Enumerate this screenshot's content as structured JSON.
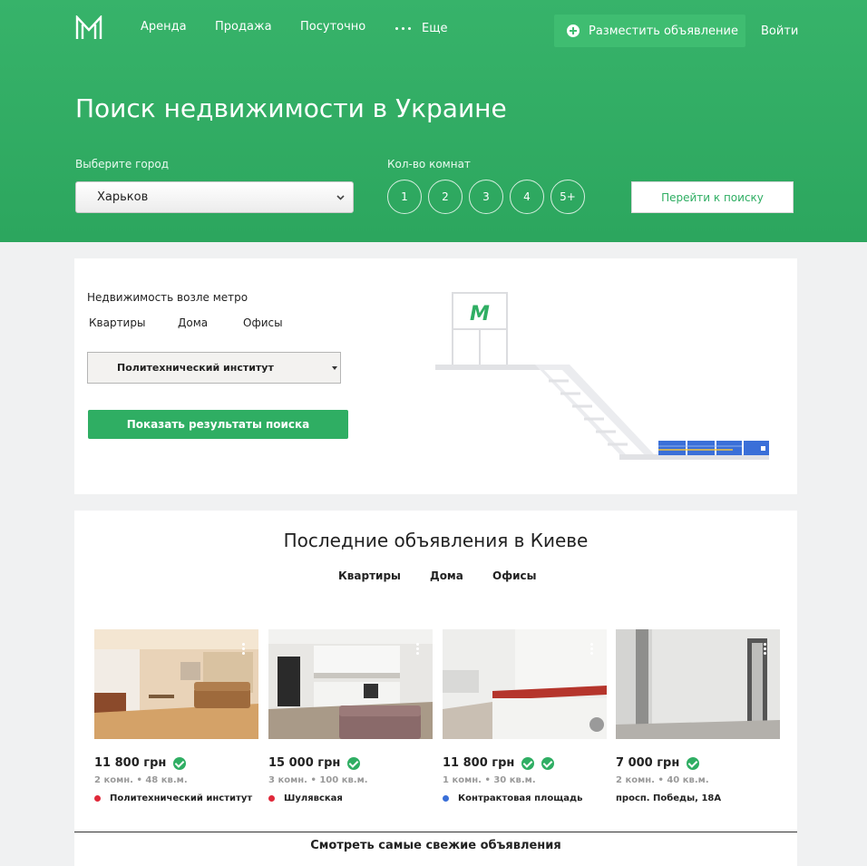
{
  "colors": {
    "brand_green": "#2fae63",
    "hero_green": "#37b36a",
    "metro_dot_red": "#e0293a",
    "metro_dot_blue": "#3a6fd8"
  },
  "header": {
    "logo_icon": "m-logo-icon",
    "nav": [
      "Аренда",
      "Продажа",
      "Посуточно"
    ],
    "more_label": "Еще",
    "post_ad_label": "Разместить объявление",
    "login_label": "Войти"
  },
  "search": {
    "title": "Поиск недвижимости в Украине",
    "city_label": "Выберите город",
    "city_value": "Харьков",
    "rooms_label": "Кол-во комнат",
    "rooms": [
      "1",
      "2",
      "3",
      "4",
      "5+"
    ],
    "go_label": "Перейти к поиску"
  },
  "metro": {
    "title": "Недвижимость возле метро",
    "tabs": [
      "Квартиры",
      "Дома",
      "Офисы"
    ],
    "station_value": "Политехнический институт",
    "show_label": "Показать результаты поиска",
    "sign_letter": "M"
  },
  "latest": {
    "title": "Последние объявления в Киеве",
    "tabs": [
      "Квартиры",
      "Дома",
      "Офисы"
    ],
    "listings": [
      {
        "price": "11 800 грн",
        "details": "2 комн. • 48 кв.м.",
        "location": "Политехнический институт",
        "metro_color": "red",
        "checks": 1
      },
      {
        "price": "15 000 грн",
        "details": "3 комн. • 100 кв.м.",
        "location": "Шулявская",
        "metro_color": "red",
        "checks": 1
      },
      {
        "price": "11 800 грн",
        "details": "1 комн. • 30 кв.м.",
        "location": "Контрактовая площадь",
        "metro_color": "blue",
        "checks": 2
      },
      {
        "price": "7 000 грн",
        "details": "2 комн. • 40 кв.м.",
        "location": "просп. Победы, 18А",
        "metro_color": "none",
        "checks": 1
      }
    ],
    "fresh_label": "Смотреть самые свежие объявления"
  }
}
